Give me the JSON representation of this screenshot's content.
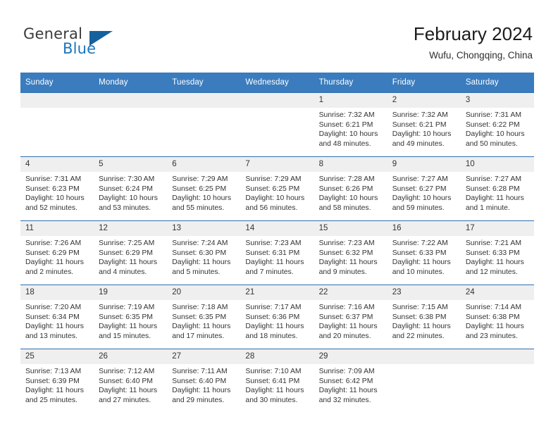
{
  "brand": {
    "name_part1": "General",
    "name_part2": "Blue"
  },
  "header": {
    "title": "February 2024",
    "subtitle": "Wufu, Chongqing, China"
  },
  "colors": {
    "header_blue": "#3a7cbe",
    "rule_blue": "#2f6fae",
    "daynum_bg": "#efefef",
    "brand_blue": "#1b75bb"
  },
  "weekday_headers": [
    "Sunday",
    "Monday",
    "Tuesday",
    "Wednesday",
    "Thursday",
    "Friday",
    "Saturday"
  ],
  "weeks": [
    [
      {
        "day": "",
        "empty": true
      },
      {
        "day": "",
        "empty": true
      },
      {
        "day": "",
        "empty": true
      },
      {
        "day": "",
        "empty": true
      },
      {
        "day": "1",
        "sunrise": "Sunrise: 7:32 AM",
        "sunset": "Sunset: 6:21 PM",
        "daylight": "Daylight: 10 hours and 48 minutes."
      },
      {
        "day": "2",
        "sunrise": "Sunrise: 7:32 AM",
        "sunset": "Sunset: 6:21 PM",
        "daylight": "Daylight: 10 hours and 49 minutes."
      },
      {
        "day": "3",
        "sunrise": "Sunrise: 7:31 AM",
        "sunset": "Sunset: 6:22 PM",
        "daylight": "Daylight: 10 hours and 50 minutes."
      }
    ],
    [
      {
        "day": "4",
        "sunrise": "Sunrise: 7:31 AM",
        "sunset": "Sunset: 6:23 PM",
        "daylight": "Daylight: 10 hours and 52 minutes."
      },
      {
        "day": "5",
        "sunrise": "Sunrise: 7:30 AM",
        "sunset": "Sunset: 6:24 PM",
        "daylight": "Daylight: 10 hours and 53 minutes."
      },
      {
        "day": "6",
        "sunrise": "Sunrise: 7:29 AM",
        "sunset": "Sunset: 6:25 PM",
        "daylight": "Daylight: 10 hours and 55 minutes."
      },
      {
        "day": "7",
        "sunrise": "Sunrise: 7:29 AM",
        "sunset": "Sunset: 6:25 PM",
        "daylight": "Daylight: 10 hours and 56 minutes."
      },
      {
        "day": "8",
        "sunrise": "Sunrise: 7:28 AM",
        "sunset": "Sunset: 6:26 PM",
        "daylight": "Daylight: 10 hours and 58 minutes."
      },
      {
        "day": "9",
        "sunrise": "Sunrise: 7:27 AM",
        "sunset": "Sunset: 6:27 PM",
        "daylight": "Daylight: 10 hours and 59 minutes."
      },
      {
        "day": "10",
        "sunrise": "Sunrise: 7:27 AM",
        "sunset": "Sunset: 6:28 PM",
        "daylight": "Daylight: 11 hours and 1 minute."
      }
    ],
    [
      {
        "day": "11",
        "sunrise": "Sunrise: 7:26 AM",
        "sunset": "Sunset: 6:29 PM",
        "daylight": "Daylight: 11 hours and 2 minutes."
      },
      {
        "day": "12",
        "sunrise": "Sunrise: 7:25 AM",
        "sunset": "Sunset: 6:29 PM",
        "daylight": "Daylight: 11 hours and 4 minutes."
      },
      {
        "day": "13",
        "sunrise": "Sunrise: 7:24 AM",
        "sunset": "Sunset: 6:30 PM",
        "daylight": "Daylight: 11 hours and 5 minutes."
      },
      {
        "day": "14",
        "sunrise": "Sunrise: 7:23 AM",
        "sunset": "Sunset: 6:31 PM",
        "daylight": "Daylight: 11 hours and 7 minutes."
      },
      {
        "day": "15",
        "sunrise": "Sunrise: 7:23 AM",
        "sunset": "Sunset: 6:32 PM",
        "daylight": "Daylight: 11 hours and 9 minutes."
      },
      {
        "day": "16",
        "sunrise": "Sunrise: 7:22 AM",
        "sunset": "Sunset: 6:33 PM",
        "daylight": "Daylight: 11 hours and 10 minutes."
      },
      {
        "day": "17",
        "sunrise": "Sunrise: 7:21 AM",
        "sunset": "Sunset: 6:33 PM",
        "daylight": "Daylight: 11 hours and 12 minutes."
      }
    ],
    [
      {
        "day": "18",
        "sunrise": "Sunrise: 7:20 AM",
        "sunset": "Sunset: 6:34 PM",
        "daylight": "Daylight: 11 hours and 13 minutes."
      },
      {
        "day": "19",
        "sunrise": "Sunrise: 7:19 AM",
        "sunset": "Sunset: 6:35 PM",
        "daylight": "Daylight: 11 hours and 15 minutes."
      },
      {
        "day": "20",
        "sunrise": "Sunrise: 7:18 AM",
        "sunset": "Sunset: 6:35 PM",
        "daylight": "Daylight: 11 hours and 17 minutes."
      },
      {
        "day": "21",
        "sunrise": "Sunrise: 7:17 AM",
        "sunset": "Sunset: 6:36 PM",
        "daylight": "Daylight: 11 hours and 18 minutes."
      },
      {
        "day": "22",
        "sunrise": "Sunrise: 7:16 AM",
        "sunset": "Sunset: 6:37 PM",
        "daylight": "Daylight: 11 hours and 20 minutes."
      },
      {
        "day": "23",
        "sunrise": "Sunrise: 7:15 AM",
        "sunset": "Sunset: 6:38 PM",
        "daylight": "Daylight: 11 hours and 22 minutes."
      },
      {
        "day": "24",
        "sunrise": "Sunrise: 7:14 AM",
        "sunset": "Sunset: 6:38 PM",
        "daylight": "Daylight: 11 hours and 23 minutes."
      }
    ],
    [
      {
        "day": "25",
        "sunrise": "Sunrise: 7:13 AM",
        "sunset": "Sunset: 6:39 PM",
        "daylight": "Daylight: 11 hours and 25 minutes."
      },
      {
        "day": "26",
        "sunrise": "Sunrise: 7:12 AM",
        "sunset": "Sunset: 6:40 PM",
        "daylight": "Daylight: 11 hours and 27 minutes."
      },
      {
        "day": "27",
        "sunrise": "Sunrise: 7:11 AM",
        "sunset": "Sunset: 6:40 PM",
        "daylight": "Daylight: 11 hours and 29 minutes."
      },
      {
        "day": "28",
        "sunrise": "Sunrise: 7:10 AM",
        "sunset": "Sunset: 6:41 PM",
        "daylight": "Daylight: 11 hours and 30 minutes."
      },
      {
        "day": "29",
        "sunrise": "Sunrise: 7:09 AM",
        "sunset": "Sunset: 6:42 PM",
        "daylight": "Daylight: 11 hours and 32 minutes."
      },
      {
        "day": "",
        "empty": true
      },
      {
        "day": "",
        "empty": true
      }
    ]
  ]
}
